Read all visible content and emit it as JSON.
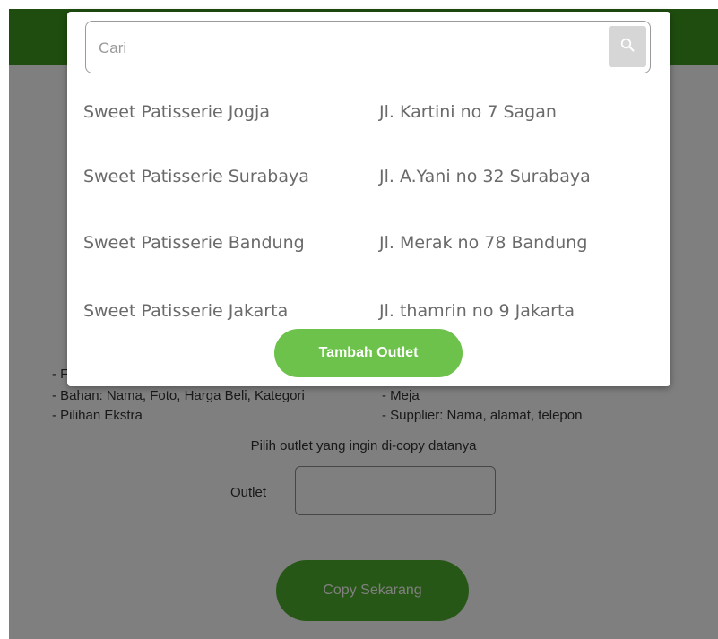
{
  "background_page": {
    "lines": [
      {
        "left": "- F",
        "right": ""
      },
      {
        "left": "- Bahan: Nama, Foto, Harga Beli, Kategori",
        "right": "- Meja"
      },
      {
        "left": "- Pilihan Ekstra",
        "right": "- Supplier: Nama, alamat, telepon"
      }
    ],
    "instruction": "Pilih outlet yang ingin di-copy datanya",
    "outlet_label": "Outlet",
    "outlet_value": "",
    "copy_button": "Copy Sekarang"
  },
  "modal": {
    "search": {
      "placeholder": "Cari",
      "value": "",
      "icon": "search-icon"
    },
    "outlets": [
      {
        "name": "Sweet Patisserie Jogja",
        "address": "Jl. Kartini no 7 Sagan"
      },
      {
        "name": "Sweet Patisserie Surabaya",
        "address": "Jl. A.Yani no 32 Surabaya"
      },
      {
        "name": "Sweet Patisserie Bandung",
        "address": "Jl. Merak no 78 Bandung"
      },
      {
        "name": "Sweet Patisserie Jakarta",
        "address": "Jl. thamrin no 9 Jakarta"
      }
    ],
    "add_button": "Tambah Outlet"
  },
  "colors": {
    "topbar": "#3f9a1e",
    "add_button": "#6cc24a",
    "copy_button": "#4fae2c",
    "overlay": "rgba(0,0,0,0.5)"
  }
}
